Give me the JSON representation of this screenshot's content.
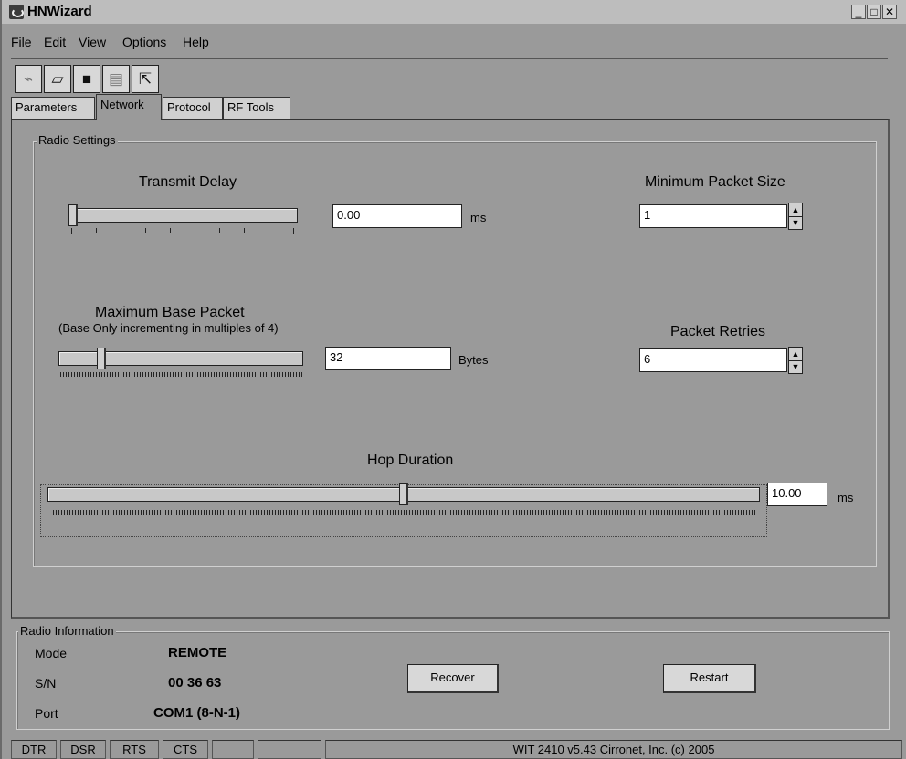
{
  "window": {
    "title": "HNWizard",
    "minimize": "_",
    "maximize": "□",
    "close": "✕"
  },
  "menu": [
    "File",
    "Edit",
    "View",
    "Options",
    "Help"
  ],
  "toolbar": {
    "icons": [
      "connect-icon",
      "open-folder-icon",
      "save-icon",
      "disk-icon",
      "export-icon"
    ]
  },
  "tabs": [
    "Parameters",
    "Network",
    "Protocol",
    "RF Tools"
  ],
  "active_tab": "Network",
  "radio_settings": {
    "legend": "Radio Settings",
    "transmit_delay": {
      "label": "Transmit Delay",
      "value": "0.00",
      "unit": "ms",
      "slider_fraction": 0.0
    },
    "minimum_packet_size": {
      "label": "Minimum Packet Size",
      "value": "1"
    },
    "max_base_packet": {
      "label": "Maximum Base Packet",
      "sublabel": "(Base Only incrementing in multiples of 4)",
      "value": "32",
      "unit": "Bytes",
      "slider_fraction": 0.17
    },
    "packet_retries": {
      "label": "Packet Retries",
      "value": "6"
    },
    "hop_duration": {
      "label": "Hop Duration",
      "value": "10.00",
      "unit": "ms",
      "slider_fraction": 0.5
    }
  },
  "radio_information": {
    "legend": "Radio Information",
    "mode_label": "Mode",
    "mode_value": "REMOTE",
    "sn_label": "S/N",
    "sn_value": "00 36 63",
    "port_label": "Port",
    "port_value": "COM1 (8-N-1)"
  },
  "buttons": {
    "recover": "Recover",
    "restart": "Restart"
  },
  "status": {
    "dtr": "DTR",
    "dsr": "DSR",
    "rts": "RTS",
    "cts": "CTS",
    "blank": "",
    "info": "WIT 2410 v5.43 Cirronet, Inc. (c) 2005"
  }
}
